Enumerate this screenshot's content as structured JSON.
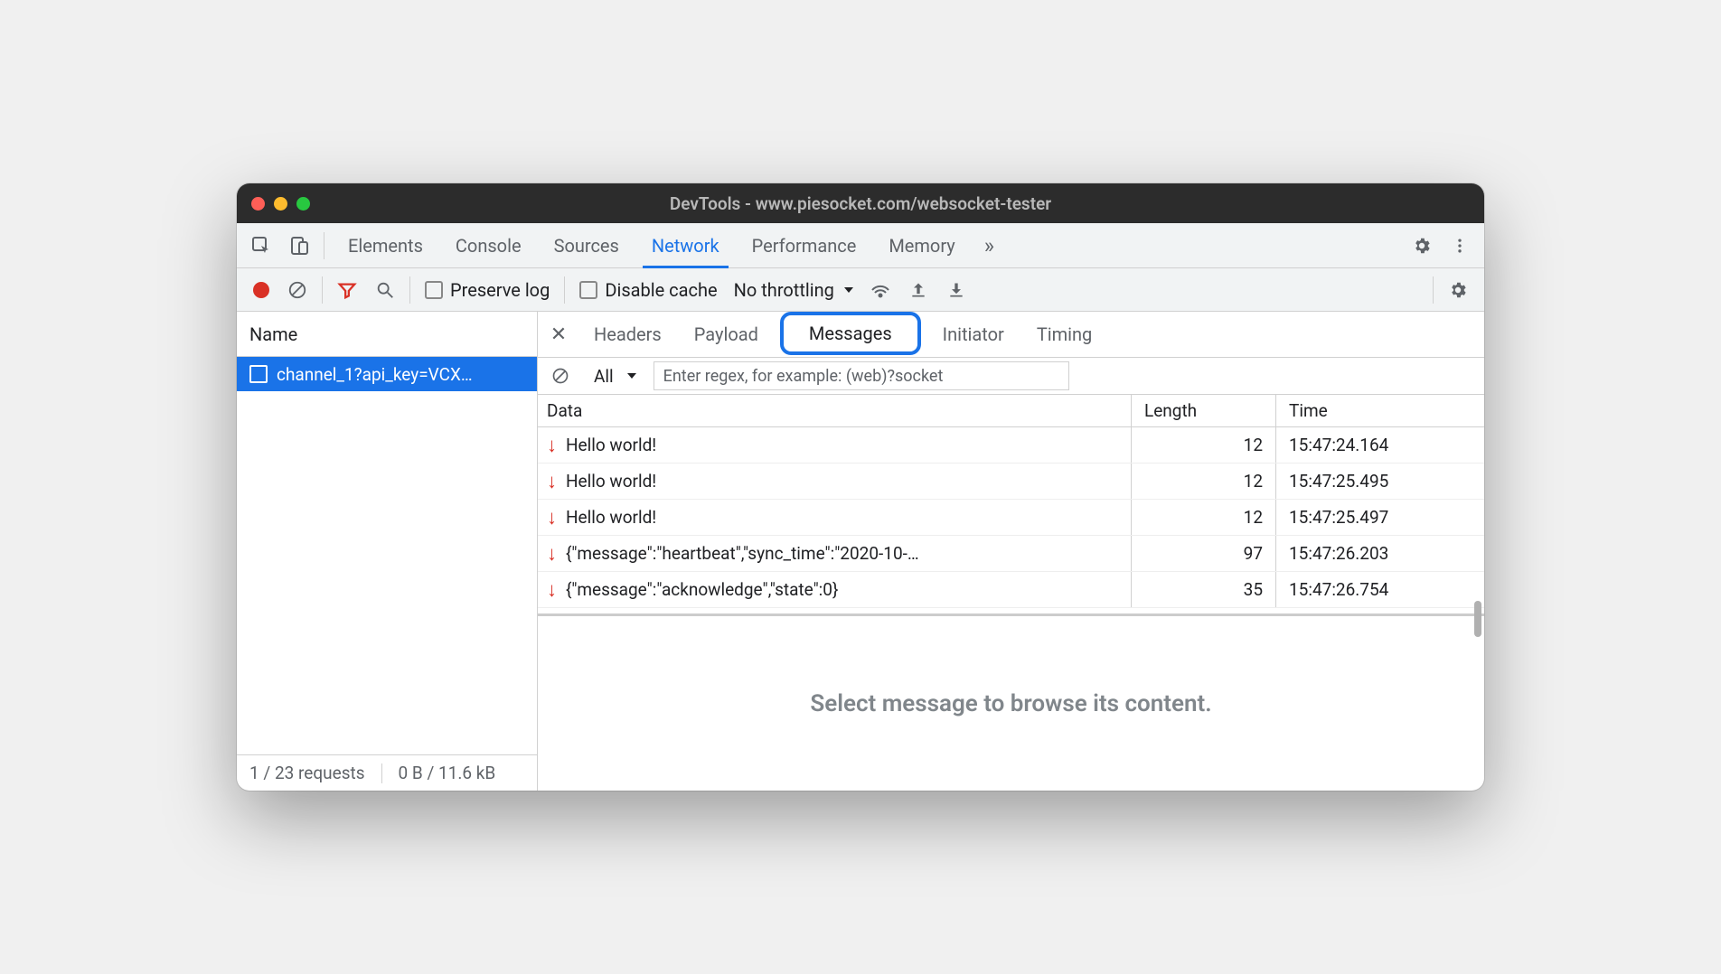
{
  "window": {
    "title": "DevTools - www.piesocket.com/websocket-tester"
  },
  "mainTabs": {
    "items": [
      "Elements",
      "Console",
      "Sources",
      "Network",
      "Performance",
      "Memory"
    ],
    "active": "Network",
    "more": "»"
  },
  "netToolbar": {
    "preserve_log": "Preserve log",
    "disable_cache": "Disable cache",
    "throttling": "No throttling"
  },
  "leftPane": {
    "header": "Name",
    "request_name": "channel_1?api_key=VCX…",
    "status_requests": "1 / 23 requests",
    "status_transfer": "0 B / 11.6 kB"
  },
  "detailTabs": {
    "items": [
      "Headers",
      "Payload",
      "Messages",
      "Initiator",
      "Timing"
    ],
    "active": "Messages"
  },
  "msgFilter": {
    "all_label": "All",
    "regex_placeholder": "Enter regex, for example: (web)?socket"
  },
  "msgTable": {
    "headers": {
      "data": "Data",
      "length": "Length",
      "time": "Time"
    },
    "rows": [
      {
        "direction": "down",
        "data": "Hello world!",
        "length": "12",
        "time": "15:47:24.164"
      },
      {
        "direction": "down",
        "data": "Hello world!",
        "length": "12",
        "time": "15:47:25.495"
      },
      {
        "direction": "down",
        "data": "Hello world!",
        "length": "12",
        "time": "15:47:25.497"
      },
      {
        "direction": "down",
        "data": "{\"message\":\"heartbeat\",\"sync_time\":\"2020-10-…",
        "length": "97",
        "time": "15:47:26.203"
      },
      {
        "direction": "down",
        "data": "{\"message\":\"acknowledge\",\"state\":0}",
        "length": "35",
        "time": "15:47:26.754"
      }
    ],
    "placeholder": "Select message to browse its content."
  }
}
